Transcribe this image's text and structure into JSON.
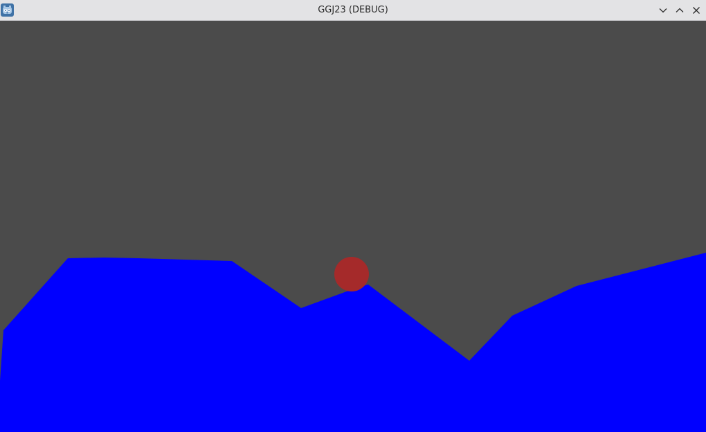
{
  "window": {
    "title": "GGJ23 (DEBUG)",
    "app_icon": "godot-engine-icon",
    "controls": [
      "minimize-icon",
      "maximize-icon",
      "close-icon"
    ]
  },
  "scene": {
    "background_color": "#4b4b4b",
    "terrain_color": "#0000ff",
    "ball_color": "#a52a2a"
  }
}
